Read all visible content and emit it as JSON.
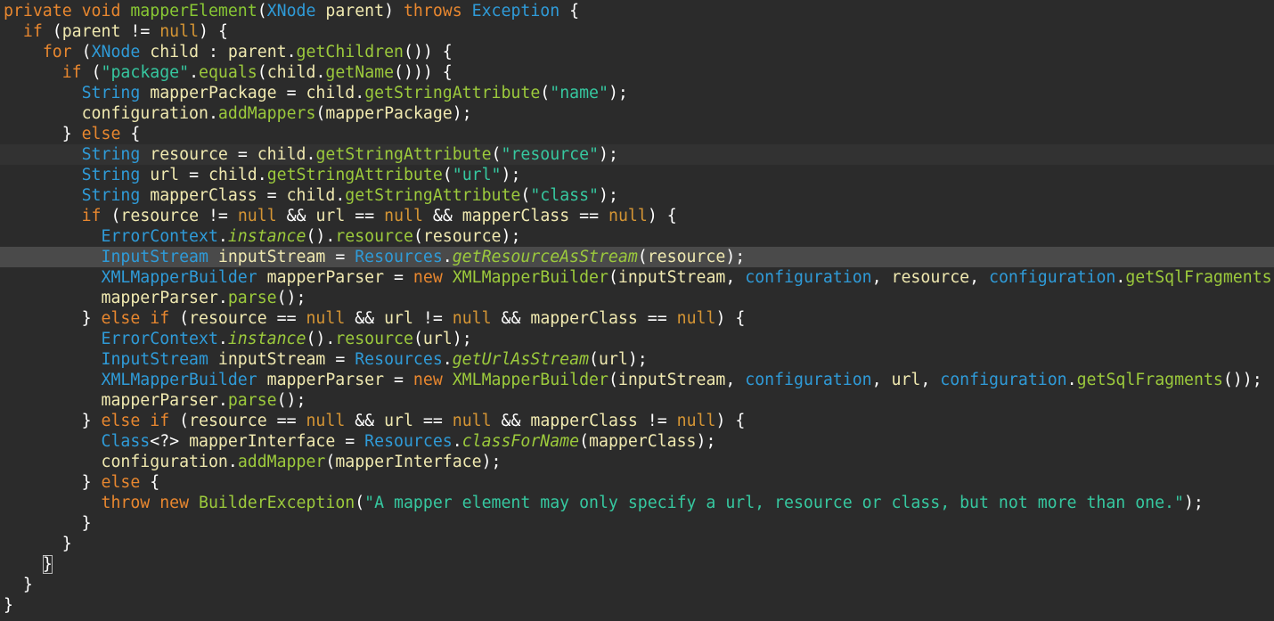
{
  "editor": {
    "language": "Java",
    "colors": {
      "background": "#2b2b2b",
      "keyword": "#e8872f",
      "type": "#2f9bd8",
      "method_decl": "#88c734",
      "method_call": "#9cca3c",
      "variable": "#f0e9b0",
      "string": "#36c8a0",
      "literal": "#d59534",
      "plain": "#ffffff"
    },
    "caret_line": 7,
    "selected_line": 12,
    "matched_bracket_line": 27,
    "lines": [
      [
        [
          "kw",
          "private "
        ],
        [
          "kw",
          "void "
        ],
        [
          "mdef",
          "mapperElement"
        ],
        [
          "pl",
          "("
        ],
        [
          "type",
          "XNode "
        ],
        [
          "var",
          "parent"
        ],
        [
          "pl",
          ") "
        ],
        [
          "kw",
          "throws "
        ],
        [
          "type",
          "Exception "
        ],
        [
          "pl",
          "{"
        ]
      ],
      [
        [
          "pl",
          "  "
        ],
        [
          "kw",
          "if "
        ],
        [
          "pl",
          "("
        ],
        [
          "var",
          "parent "
        ],
        [
          "pl",
          "!= "
        ],
        [
          "lit",
          "null"
        ],
        [
          "pl",
          ") {"
        ]
      ],
      [
        [
          "pl",
          "    "
        ],
        [
          "kw",
          "for "
        ],
        [
          "pl",
          "("
        ],
        [
          "type",
          "XNode "
        ],
        [
          "var",
          "child "
        ],
        [
          "pl",
          ": "
        ],
        [
          "var",
          "parent"
        ],
        [
          "pl",
          "."
        ],
        [
          "call",
          "getChildren"
        ],
        [
          "pl",
          "()) {"
        ]
      ],
      [
        [
          "pl",
          "      "
        ],
        [
          "kw",
          "if "
        ],
        [
          "pl",
          "("
        ],
        [
          "str",
          "\"package\""
        ],
        [
          "pl",
          "."
        ],
        [
          "call",
          "equals"
        ],
        [
          "pl",
          "("
        ],
        [
          "var",
          "child"
        ],
        [
          "pl",
          "."
        ],
        [
          "call",
          "getName"
        ],
        [
          "pl",
          "())) {"
        ]
      ],
      [
        [
          "pl",
          "        "
        ],
        [
          "type",
          "String "
        ],
        [
          "var",
          "mapperPackage "
        ],
        [
          "pl",
          "= "
        ],
        [
          "var",
          "child"
        ],
        [
          "pl",
          "."
        ],
        [
          "call",
          "getStringAttribute"
        ],
        [
          "pl",
          "("
        ],
        [
          "str",
          "\"name\""
        ],
        [
          "pl",
          ");"
        ]
      ],
      [
        [
          "pl",
          "        "
        ],
        [
          "var",
          "configuration"
        ],
        [
          "pl",
          "."
        ],
        [
          "call",
          "addMappers"
        ],
        [
          "pl",
          "("
        ],
        [
          "var",
          "mapperPackage"
        ],
        [
          "pl",
          ");"
        ]
      ],
      [
        [
          "pl",
          "      } "
        ],
        [
          "kw",
          "else "
        ],
        [
          "pl",
          "{"
        ]
      ],
      [
        [
          "pl",
          "        "
        ],
        [
          "type",
          "String "
        ],
        [
          "var",
          "resource "
        ],
        [
          "pl",
          "= "
        ],
        [
          "var",
          "child"
        ],
        [
          "pl",
          "."
        ],
        [
          "call",
          "getStringAttribute"
        ],
        [
          "pl",
          "("
        ],
        [
          "str",
          "\"resource\""
        ],
        [
          "pl",
          ");"
        ]
      ],
      [
        [
          "pl",
          "        "
        ],
        [
          "type",
          "String "
        ],
        [
          "var",
          "url "
        ],
        [
          "pl",
          "= "
        ],
        [
          "var",
          "child"
        ],
        [
          "pl",
          "."
        ],
        [
          "call",
          "getStringAttribute"
        ],
        [
          "pl",
          "("
        ],
        [
          "str",
          "\"url\""
        ],
        [
          "pl",
          ");"
        ]
      ],
      [
        [
          "pl",
          "        "
        ],
        [
          "type",
          "String "
        ],
        [
          "var",
          "mapperClass "
        ],
        [
          "pl",
          "= "
        ],
        [
          "var",
          "child"
        ],
        [
          "pl",
          "."
        ],
        [
          "call",
          "getStringAttribute"
        ],
        [
          "pl",
          "("
        ],
        [
          "str",
          "\"class\""
        ],
        [
          "pl",
          ");"
        ]
      ],
      [
        [
          "pl",
          "        "
        ],
        [
          "kw",
          "if "
        ],
        [
          "pl",
          "("
        ],
        [
          "var",
          "resource "
        ],
        [
          "pl",
          "!= "
        ],
        [
          "lit",
          "null "
        ],
        [
          "pl",
          "&& "
        ],
        [
          "var",
          "url "
        ],
        [
          "pl",
          "== "
        ],
        [
          "lit",
          "null "
        ],
        [
          "pl",
          "&& "
        ],
        [
          "var",
          "mapperClass "
        ],
        [
          "pl",
          "== "
        ],
        [
          "lit",
          "null"
        ],
        [
          "pl",
          ") {"
        ]
      ],
      [
        [
          "pl",
          "          "
        ],
        [
          "type",
          "ErrorContext"
        ],
        [
          "pl",
          "."
        ],
        [
          "stc",
          "instance"
        ],
        [
          "pl",
          "()."
        ],
        [
          "call",
          "resource"
        ],
        [
          "pl",
          "("
        ],
        [
          "var",
          "resource"
        ],
        [
          "pl",
          ");"
        ]
      ],
      [
        [
          "pl",
          "          "
        ],
        [
          "type",
          "InputStream "
        ],
        [
          "var",
          "inputStream "
        ],
        [
          "pl",
          "= "
        ],
        [
          "type",
          "Resources"
        ],
        [
          "pl",
          "."
        ],
        [
          "stc",
          "getResourceAsStream"
        ],
        [
          "pl",
          "("
        ],
        [
          "var",
          "resource"
        ],
        [
          "pl",
          ");"
        ]
      ],
      [
        [
          "pl",
          "          "
        ],
        [
          "type",
          "XMLMapperBuilder "
        ],
        [
          "var",
          "mapperParser "
        ],
        [
          "pl",
          "= "
        ],
        [
          "kw",
          "new "
        ],
        [
          "call",
          "XMLMapperBuilder"
        ],
        [
          "pl",
          "("
        ],
        [
          "var",
          "inputStream"
        ],
        [
          "pl",
          ", "
        ],
        [
          "type",
          "configuration"
        ],
        [
          "pl",
          ", "
        ],
        [
          "var",
          "resource"
        ],
        [
          "pl",
          ", "
        ],
        [
          "type",
          "configuration"
        ],
        [
          "pl",
          "."
        ],
        [
          "call",
          "getSqlFragments"
        ]
      ],
      [
        [
          "pl",
          "          "
        ],
        [
          "var",
          "mapperParser"
        ],
        [
          "pl",
          "."
        ],
        [
          "call",
          "parse"
        ],
        [
          "pl",
          "();"
        ]
      ],
      [
        [
          "pl",
          "        } "
        ],
        [
          "kw",
          "else if "
        ],
        [
          "pl",
          "("
        ],
        [
          "var",
          "resource "
        ],
        [
          "pl",
          "== "
        ],
        [
          "lit",
          "null "
        ],
        [
          "pl",
          "&& "
        ],
        [
          "var",
          "url "
        ],
        [
          "pl",
          "!= "
        ],
        [
          "lit",
          "null "
        ],
        [
          "pl",
          "&& "
        ],
        [
          "var",
          "mapperClass "
        ],
        [
          "pl",
          "== "
        ],
        [
          "lit",
          "null"
        ],
        [
          "pl",
          ") {"
        ]
      ],
      [
        [
          "pl",
          "          "
        ],
        [
          "type",
          "ErrorContext"
        ],
        [
          "pl",
          "."
        ],
        [
          "stc",
          "instance"
        ],
        [
          "pl",
          "()."
        ],
        [
          "call",
          "resource"
        ],
        [
          "pl",
          "("
        ],
        [
          "var",
          "url"
        ],
        [
          "pl",
          ");"
        ]
      ],
      [
        [
          "pl",
          "          "
        ],
        [
          "type",
          "InputStream "
        ],
        [
          "var",
          "inputStream "
        ],
        [
          "pl",
          "= "
        ],
        [
          "type",
          "Resources"
        ],
        [
          "pl",
          "."
        ],
        [
          "stc",
          "getUrlAsStream"
        ],
        [
          "pl",
          "("
        ],
        [
          "var",
          "url"
        ],
        [
          "pl",
          ");"
        ]
      ],
      [
        [
          "pl",
          "          "
        ],
        [
          "type",
          "XMLMapperBuilder "
        ],
        [
          "var",
          "mapperParser "
        ],
        [
          "pl",
          "= "
        ],
        [
          "kw",
          "new "
        ],
        [
          "call",
          "XMLMapperBuilder"
        ],
        [
          "pl",
          "("
        ],
        [
          "var",
          "inputStream"
        ],
        [
          "pl",
          ", "
        ],
        [
          "type",
          "configuration"
        ],
        [
          "pl",
          ", "
        ],
        [
          "var",
          "url"
        ],
        [
          "pl",
          ", "
        ],
        [
          "type",
          "configuration"
        ],
        [
          "pl",
          "."
        ],
        [
          "call",
          "getSqlFragments"
        ],
        [
          "pl",
          "());"
        ]
      ],
      [
        [
          "pl",
          "          "
        ],
        [
          "var",
          "mapperParser"
        ],
        [
          "pl",
          "."
        ],
        [
          "call",
          "parse"
        ],
        [
          "pl",
          "();"
        ]
      ],
      [
        [
          "pl",
          "        } "
        ],
        [
          "kw",
          "else if "
        ],
        [
          "pl",
          "("
        ],
        [
          "var",
          "resource "
        ],
        [
          "pl",
          "== "
        ],
        [
          "lit",
          "null "
        ],
        [
          "pl",
          "&& "
        ],
        [
          "var",
          "url "
        ],
        [
          "pl",
          "== "
        ],
        [
          "lit",
          "null "
        ],
        [
          "pl",
          "&& "
        ],
        [
          "var",
          "mapperClass "
        ],
        [
          "pl",
          "!= "
        ],
        [
          "lit",
          "null"
        ],
        [
          "pl",
          ") {"
        ]
      ],
      [
        [
          "pl",
          "          "
        ],
        [
          "type",
          "Class"
        ],
        [
          "pl",
          "<?> "
        ],
        [
          "var",
          "mapperInterface "
        ],
        [
          "pl",
          "= "
        ],
        [
          "type",
          "Resources"
        ],
        [
          "pl",
          "."
        ],
        [
          "stc",
          "classForName"
        ],
        [
          "pl",
          "("
        ],
        [
          "var",
          "mapperClass"
        ],
        [
          "pl",
          ");"
        ]
      ],
      [
        [
          "pl",
          "          "
        ],
        [
          "var",
          "configuration"
        ],
        [
          "pl",
          "."
        ],
        [
          "call",
          "addMapper"
        ],
        [
          "pl",
          "("
        ],
        [
          "var",
          "mapperInterface"
        ],
        [
          "pl",
          ");"
        ]
      ],
      [
        [
          "pl",
          "        } "
        ],
        [
          "kw",
          "else "
        ],
        [
          "pl",
          "{"
        ]
      ],
      [
        [
          "pl",
          "          "
        ],
        [
          "kw",
          "throw "
        ],
        [
          "kw",
          "new "
        ],
        [
          "call",
          "BuilderException"
        ],
        [
          "pl",
          "("
        ],
        [
          "str",
          "\"A mapper element may only specify a url, resource or class, but not more than one.\""
        ],
        [
          "pl",
          ");"
        ]
      ],
      [
        [
          "pl",
          "        }"
        ]
      ],
      [
        [
          "pl",
          "      }"
        ]
      ],
      [
        [
          "pl",
          "    }"
        ]
      ],
      [
        [
          "pl",
          "  }"
        ]
      ],
      [
        [
          "pl",
          "}"
        ]
      ]
    ]
  }
}
